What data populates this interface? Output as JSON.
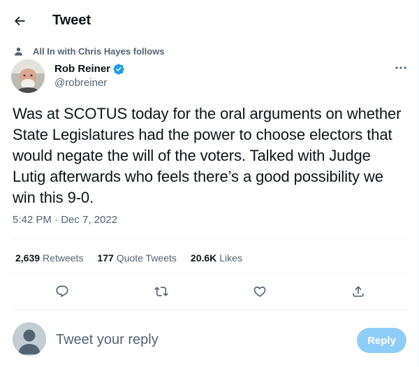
{
  "header": {
    "title": "Tweet",
    "back_icon": "arrow-left-icon"
  },
  "social_context": {
    "icon": "person-icon",
    "text": "All In with Chris Hayes follows"
  },
  "author": {
    "name": "Rob Reiner",
    "handle": "@robreiner",
    "verified": true,
    "verified_color": "#1d9bf0"
  },
  "tweet": {
    "text": "Was at SCOTUS today for the oral arguments on whether State Legislatures had the power to choose electors that would negate the will of the voters. Talked with Judge Lutig afterwards who feels there’s a good possibility we win this 9-0.",
    "time": "5:42 PM",
    "separator": "·",
    "date": "Dec 7, 2022"
  },
  "stats": [
    {
      "count": "2,639",
      "label": "Retweets"
    },
    {
      "count": "177",
      "label": "Quote Tweets"
    },
    {
      "count": "20.6K",
      "label": "Likes"
    }
  ],
  "actions": [
    {
      "icon": "reply-icon"
    },
    {
      "icon": "retweet-icon"
    },
    {
      "icon": "like-icon"
    },
    {
      "icon": "share-icon"
    }
  ],
  "reply": {
    "placeholder": "Tweet your reply",
    "button_label": "Reply",
    "button_color": "#8ecdf8"
  },
  "colors": {
    "text": "#0f1419",
    "secondary": "#536471",
    "divider": "#eff3f4",
    "accent": "#1d9bf0"
  }
}
